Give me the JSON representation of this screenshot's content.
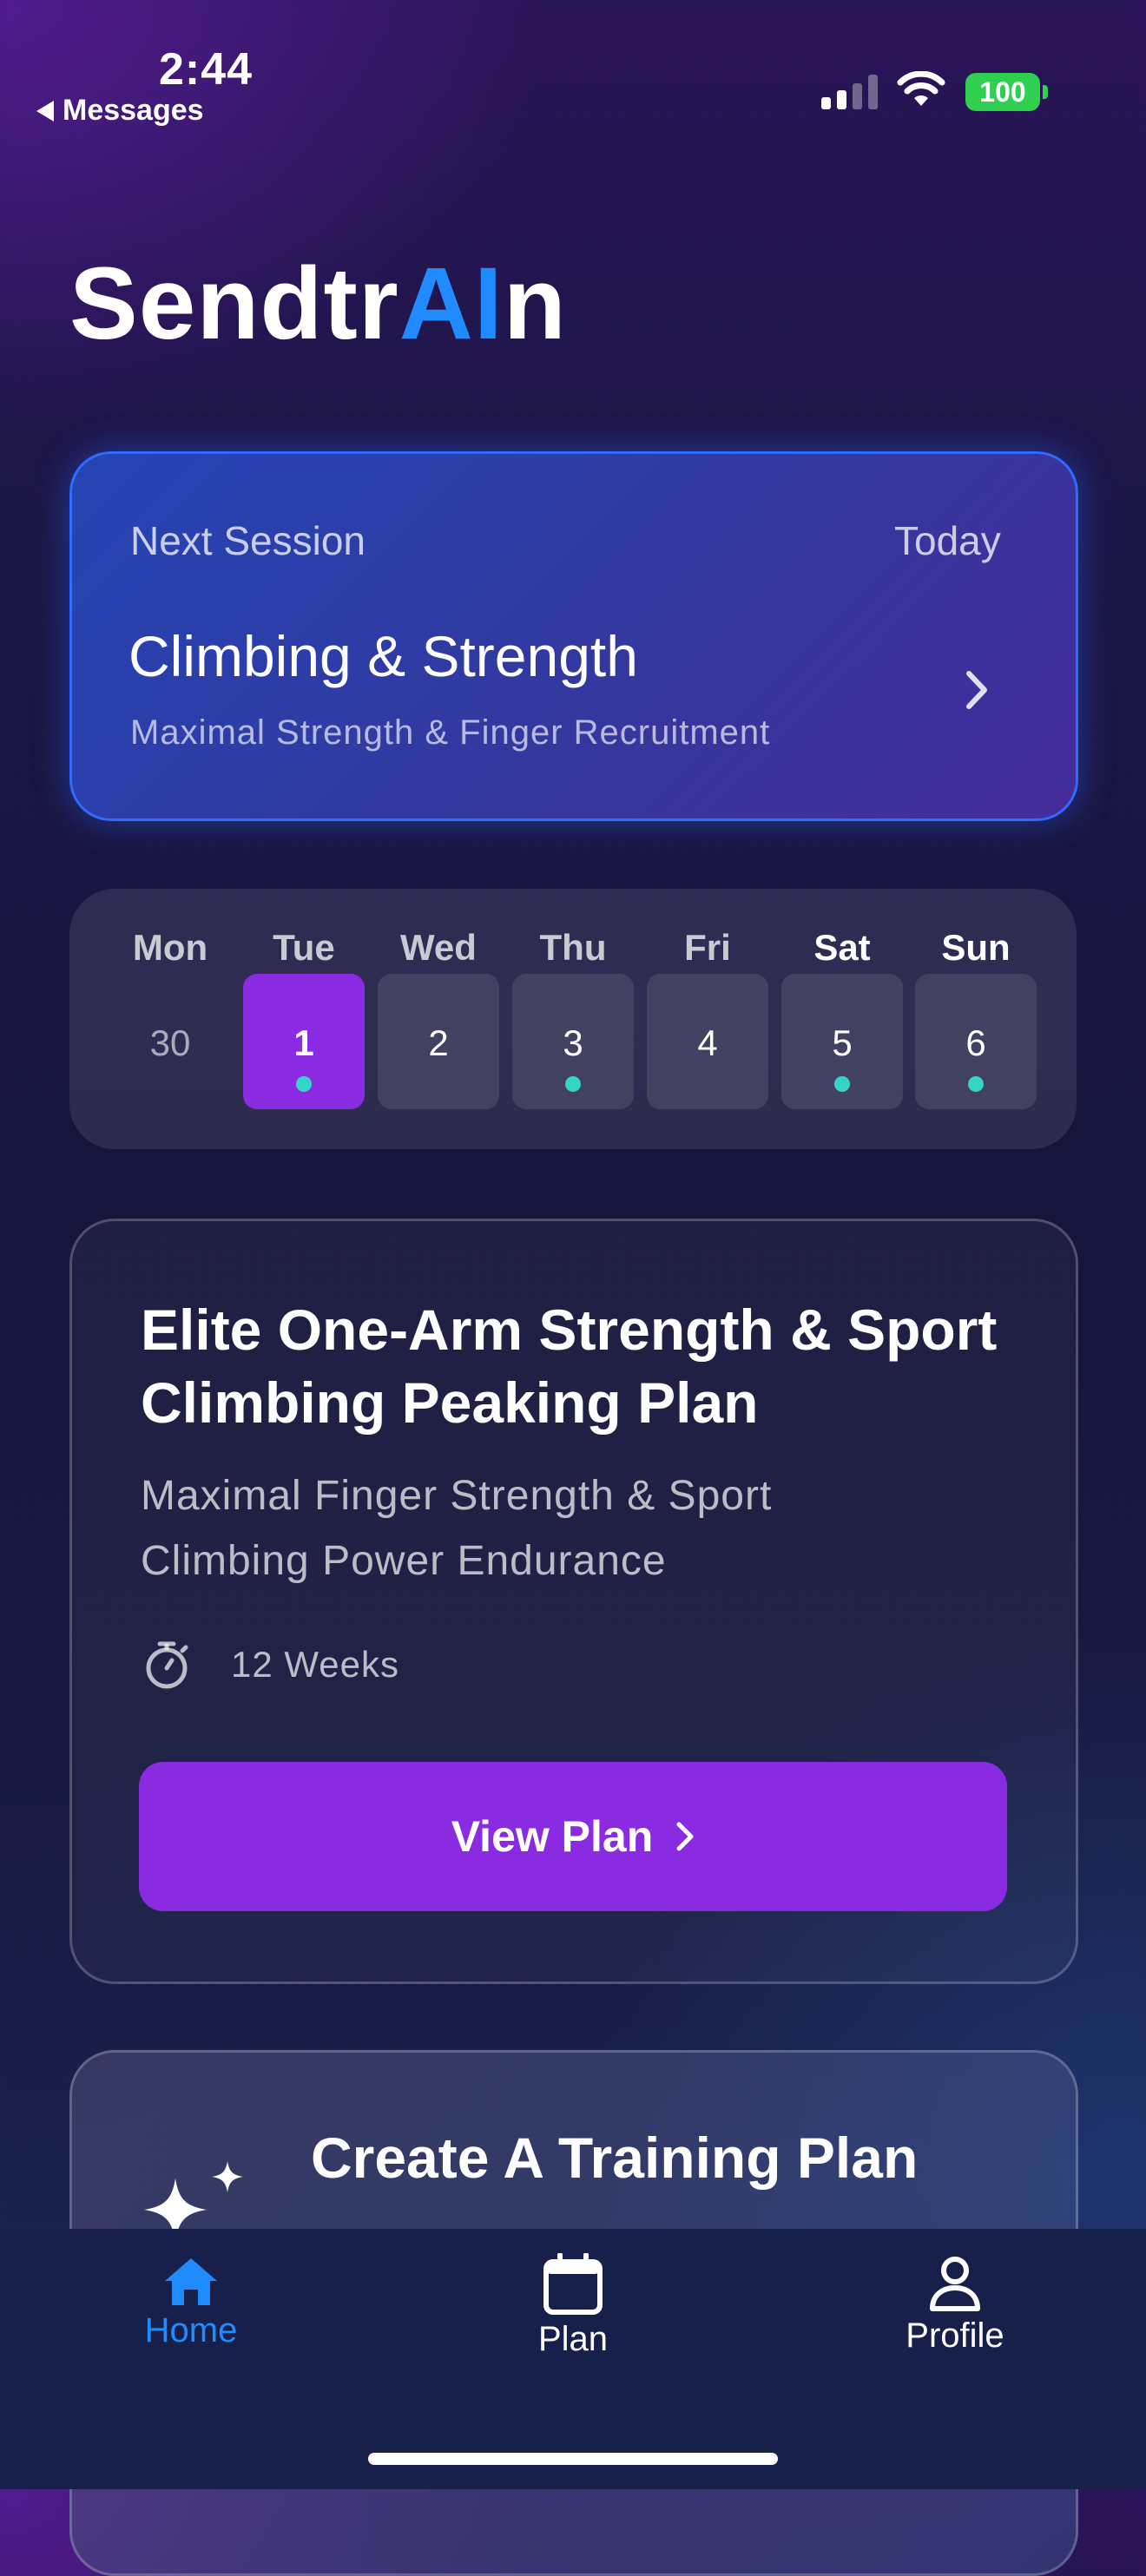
{
  "status_bar": {
    "time": "2:44",
    "back_label": "Messages",
    "battery": "100",
    "signal_icon": "cellular-signal-icon",
    "wifi_icon": "wifi-icon"
  },
  "app": {
    "logo_prefix": "Sendtr",
    "logo_highlight": "AI",
    "logo_suffix": "n",
    "accent_color": "#1f8bff",
    "primary_color": "#8a2be2"
  },
  "next_session": {
    "label": "Next Session",
    "day": "Today",
    "title": "Climbing & Strength",
    "subtitle": "Maximal Strength & Finger Recruitment"
  },
  "week": {
    "days": [
      {
        "name": "Mon",
        "number": "30",
        "has_session": false,
        "selected": false
      },
      {
        "name": "Tue",
        "number": "1",
        "has_session": true,
        "selected": true
      },
      {
        "name": "Wed",
        "number": "2",
        "has_session": false,
        "selected": false
      },
      {
        "name": "Thu",
        "number": "3",
        "has_session": true,
        "selected": false
      },
      {
        "name": "Fri",
        "number": "4",
        "has_session": false,
        "selected": false
      },
      {
        "name": "Sat",
        "number": "5",
        "has_session": true,
        "selected": false
      },
      {
        "name": "Sun",
        "number": "6",
        "has_session": true,
        "selected": false
      }
    ]
  },
  "plan": {
    "title": "Elite One-Arm Strength & Sport Climbing Peaking Plan",
    "subtitle": "Maximal Finger Strength & Sport Climbing Power Endurance",
    "duration": "12 Weeks",
    "button_label": "View Plan"
  },
  "create_plan": {
    "title": "Create A Training Plan"
  },
  "tabbar": {
    "items": [
      {
        "label": "Home",
        "icon": "home-icon",
        "active": true
      },
      {
        "label": "Plan",
        "icon": "calendar-icon",
        "active": false
      },
      {
        "label": "Profile",
        "icon": "person-icon",
        "active": false
      }
    ]
  }
}
